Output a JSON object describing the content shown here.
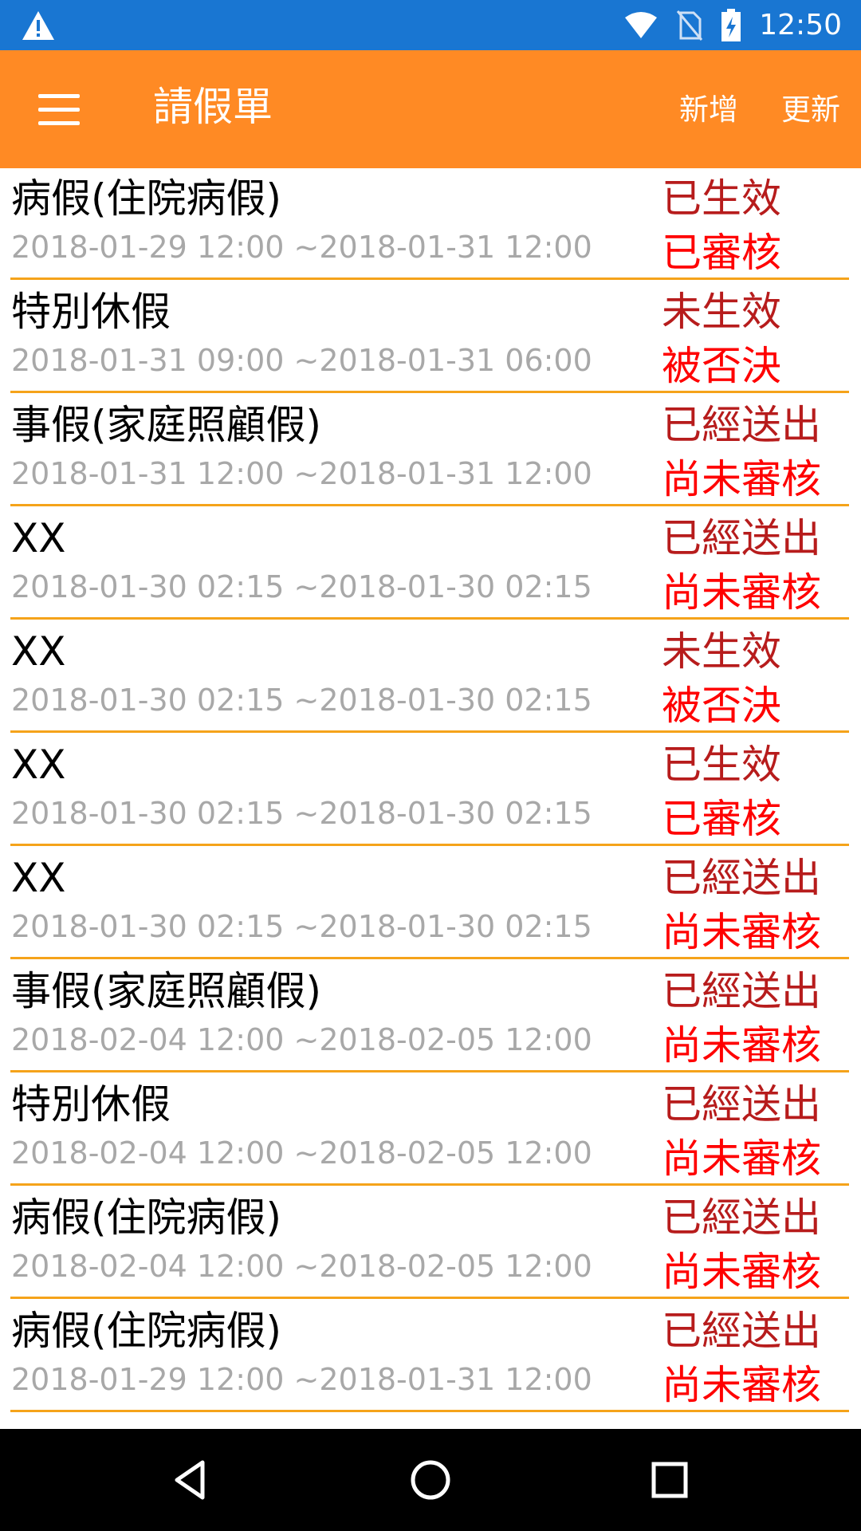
{
  "status_bar": {
    "time": "12:50",
    "icons": [
      "warning-icon",
      "wifi-icon",
      "no-sim-icon",
      "battery-charging-icon"
    ]
  },
  "app_bar": {
    "title": "請假單",
    "add_label": "新增",
    "refresh_label": "更新",
    "menu_icon": "hamburger-menu-icon"
  },
  "leaves": [
    {
      "name": "病假(住院病假)",
      "dates": "2018-01-29 12:00 ~2018-01-31 12:00",
      "status": "已生效",
      "review": "已審核"
    },
    {
      "name": "特別休假",
      "dates": "2018-01-31 09:00 ~2018-01-31 06:00",
      "status": "未生效",
      "review": "被否決"
    },
    {
      "name": "事假(家庭照顧假)",
      "dates": "2018-01-31 12:00 ~2018-01-31 12:00",
      "status": "已經送出",
      "review": "尚未審核"
    },
    {
      "name": "XX",
      "dates": "2018-01-30 02:15 ~2018-01-30 02:15",
      "status": "已經送出",
      "review": "尚未審核"
    },
    {
      "name": "XX",
      "dates": "2018-01-30 02:15 ~2018-01-30 02:15",
      "status": "未生效",
      "review": "被否決"
    },
    {
      "name": "XX",
      "dates": "2018-01-30 02:15 ~2018-01-30 02:15",
      "status": "已生效",
      "review": "已審核"
    },
    {
      "name": "XX",
      "dates": "2018-01-30 02:15 ~2018-01-30 02:15",
      "status": "已經送出",
      "review": "尚未審核"
    },
    {
      "name": "事假(家庭照顧假)",
      "dates": "2018-02-04 12:00 ~2018-02-05 12:00",
      "status": "已經送出",
      "review": "尚未審核"
    },
    {
      "name": "特別休假",
      "dates": "2018-02-04 12:00 ~2018-02-05 12:00",
      "status": "已經送出",
      "review": "尚未審核"
    },
    {
      "name": "病假(住院病假)",
      "dates": "2018-02-04 12:00 ~2018-02-05 12:00",
      "status": "已經送出",
      "review": "尚未審核"
    },
    {
      "name": "病假(住院病假)",
      "dates": "2018-01-29 12:00 ~2018-01-31 12:00",
      "status": "已經送出",
      "review": "尚未審核"
    }
  ],
  "nav_bar": {
    "icons": [
      "back-icon",
      "home-icon",
      "recents-icon"
    ]
  },
  "colors": {
    "status_bar": "#1976d2",
    "app_bar": "#ff8a24",
    "divider": "#f5a31a",
    "status_text": "#b71c1c",
    "review_text": "#ff0000",
    "date_text": "#a8a8a8"
  }
}
